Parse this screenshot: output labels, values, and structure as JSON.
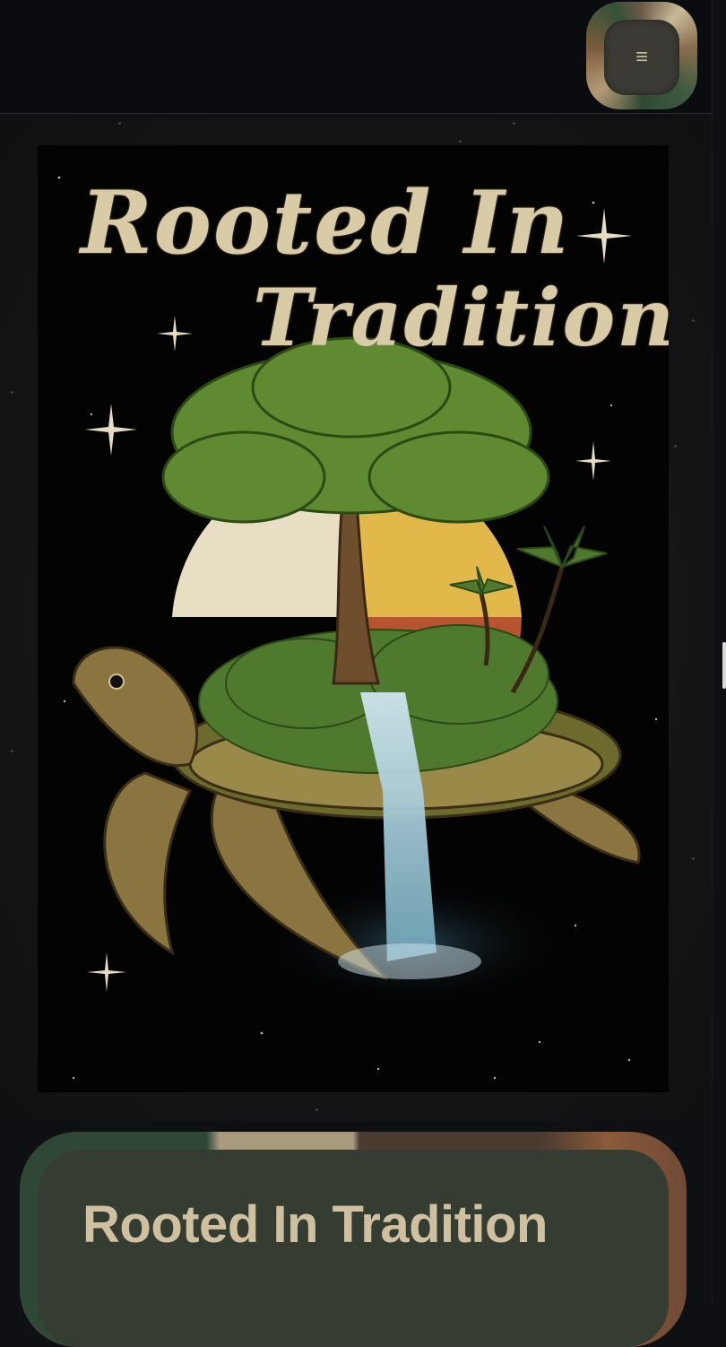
{
  "header": {
    "menu_label": "≡"
  },
  "poster": {
    "line1": "Rooted In",
    "line2": "Tradition"
  },
  "card": {
    "title": "Rooted In Tradition"
  },
  "colors": {
    "page_bg": "#0f1013",
    "header_bg": "#0a0c10",
    "poster_bg": "#030303",
    "card_bg": "#353c32",
    "title_text": "#cfc0a0",
    "leaf_green": "#4f7a2e",
    "sun_yellow": "#e3b84a",
    "moon_cream": "#e8dec4",
    "water": "#9cc7d6"
  }
}
